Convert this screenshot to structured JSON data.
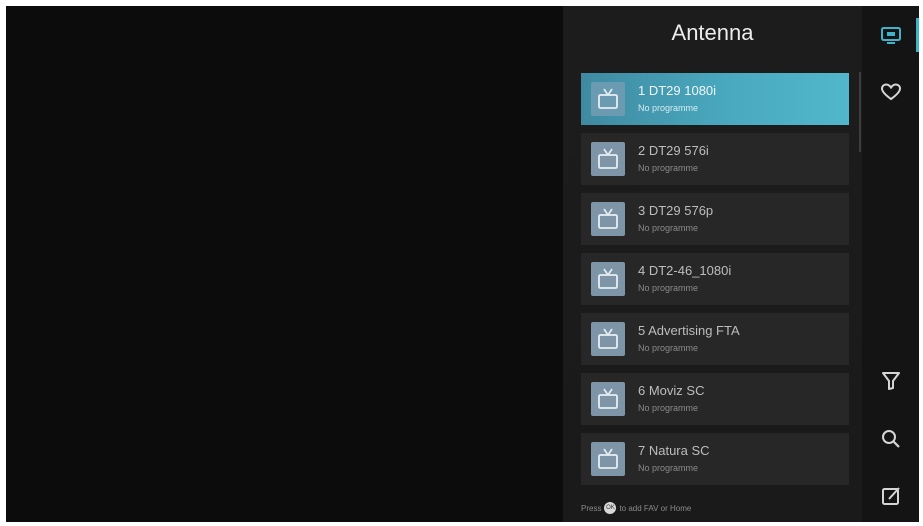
{
  "panel": {
    "title": "Antenna",
    "hint_prefix": "Press",
    "hint_key": "OK",
    "hint_suffix": "to add FAV or Home"
  },
  "channels": [
    {
      "name": "1 DT29 1080i",
      "program": "No programme",
      "selected": true
    },
    {
      "name": "2 DT29 576i",
      "program": "No programme",
      "selected": false
    },
    {
      "name": "3 DT29 576p",
      "program": "No programme",
      "selected": false
    },
    {
      "name": "4 DT2-46_1080i",
      "program": "No programme",
      "selected": false
    },
    {
      "name": "5 Advertising FTA",
      "program": "No programme",
      "selected": false
    },
    {
      "name": "6 Moviz SC",
      "program": "No programme",
      "selected": false
    },
    {
      "name": "7 Natura SC",
      "program": "No programme",
      "selected": false
    }
  ],
  "sidebar": {
    "items": [
      {
        "icon": "tv-list-icon",
        "active": true
      },
      {
        "icon": "heart-icon",
        "active": false
      },
      {
        "icon": "filter-icon",
        "active": false
      },
      {
        "icon": "search-icon",
        "active": false
      },
      {
        "icon": "edit-icon",
        "active": false
      }
    ]
  },
  "colors": {
    "accent": "#49a9bf",
    "panel_bg": "#1c1c1c",
    "item_bg": "#272727",
    "icon_bg": "#7d95a7"
  }
}
